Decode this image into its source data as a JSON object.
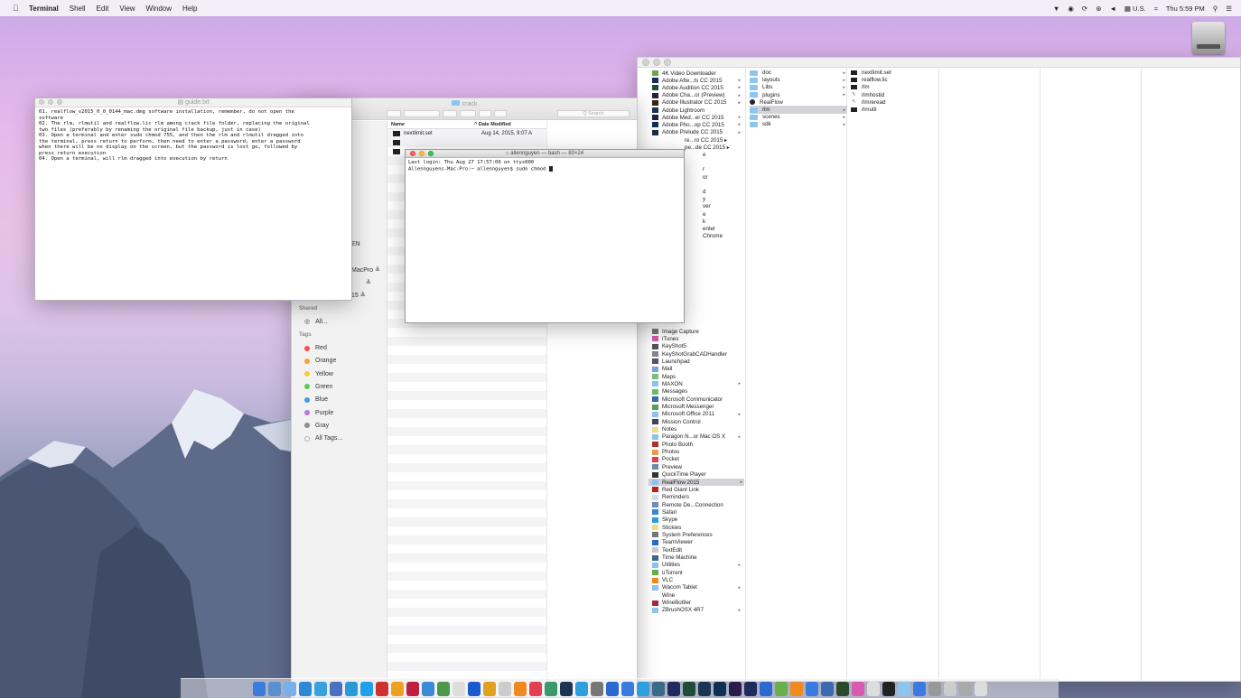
{
  "menubar": {
    "app_name": "Terminal",
    "menus": [
      "Shell",
      "Edit",
      "View",
      "Window",
      "Help"
    ],
    "status": {
      "input": "U.S.",
      "clock": "Thu 5:59 PM"
    }
  },
  "guide_window": {
    "title": "guide.txt",
    "lines": [
      "01. realflow_v2015_0_0_0144_mac.dmg software installation, remember, do not open the",
      "software",
      "02. The rlm, rlmutil and realflow.lic rlm among crack file folder, replacing the original",
      "two files (preferably by renaming the original file backup, just in case)",
      "03. Open a terminal and enter sudo chmod 755, and then the rlm and rlmutil dragged into",
      "the terminal, press return to perform, then need to enter a password, enter a password",
      "when there will be no display on the screen, but the password is lost go, followed by",
      "press return execution",
      "04. Open a terminal, will rlm dragged into execution by return"
    ]
  },
  "crack_window": {
    "title": "crack",
    "search_placeholder": "Q Search",
    "col_name": "Name",
    "col_date": "^  Date Modified",
    "files": [
      {
        "name": "nextlimit.set",
        "date": "Aug 14, 2015, 9:07 A"
      }
    ],
    "sidebar_partial": [
      "EN",
      "MacPro ≜",
      "≜",
      "15    ≜"
    ],
    "shared_label": "Shared",
    "shared_all": "All...",
    "tags_label": "Tags",
    "tags": [
      {
        "name": "Red",
        "color": "#f4504a"
      },
      {
        "name": "Orange",
        "color": "#f6a23a"
      },
      {
        "name": "Yellow",
        "color": "#f4cf3a"
      },
      {
        "name": "Green",
        "color": "#5ec94f"
      },
      {
        "name": "Blue",
        "color": "#3e9bef"
      },
      {
        "name": "Purple",
        "color": "#b67bd8"
      },
      {
        "name": "Gray",
        "color": "#8e8e92"
      },
      {
        "name": "All Tags...",
        "color": "#ffffff"
      }
    ]
  },
  "terminal": {
    "title": "allennguyen — bash — 80×24",
    "line1": "Last login: Thu Aug 27 17:57:00 on ttys000",
    "line2": "Allennguyens-Mac-Pro:~ allennguyen$ sudo chmod "
  },
  "apps_window": {
    "applications": [
      {
        "name": "4K Video Downloader",
        "color": "#6aa84f",
        "arrow": false
      },
      {
        "name": "Adobe Afte...ts CC 2015",
        "color": "#1f2a5e",
        "arrow": true
      },
      {
        "name": "Adobe Audition CC 2015",
        "color": "#1c4c3a",
        "arrow": true
      },
      {
        "name": "Adobe Cha...or (Preview)",
        "color": "#2a1f3d",
        "arrow": true
      },
      {
        "name": "Adobe Illustrator CC 2015",
        "color": "#3a2410",
        "arrow": true
      },
      {
        "name": "Adobe Lightroom",
        "color": "#1c3552",
        "arrow": false
      },
      {
        "name": "Adobe Med...er CC 2015",
        "color": "#2a1c48",
        "arrow": true
      },
      {
        "name": "Adobe Pho...op CC 2015",
        "color": "#0f3052",
        "arrow": true
      },
      {
        "name": "Adobe Prelude CC 2015",
        "color": "#1c2f4a",
        "arrow": true
      },
      {
        "name": "Image Capture",
        "color": "#777",
        "arrow": false
      },
      {
        "name": "iTunes",
        "color": "#d95ab0",
        "arrow": false
      },
      {
        "name": "KeyShot5",
        "color": "#555",
        "arrow": false
      },
      {
        "name": "KeyShotGrabCADHandler",
        "color": "#888",
        "arrow": false
      },
      {
        "name": "Launchpad",
        "color": "#556",
        "arrow": false
      },
      {
        "name": "Mail",
        "color": "#7aa6d6",
        "arrow": false
      },
      {
        "name": "Maps",
        "color": "#7cc07a",
        "arrow": false
      },
      {
        "name": "MAXON",
        "color": "#8ec5ef",
        "arrow": true
      },
      {
        "name": "Messages",
        "color": "#6ac06a",
        "arrow": false
      },
      {
        "name": "Microsoft Communicator",
        "color": "#3a6ab0",
        "arrow": false
      },
      {
        "name": "Microsoft Messenger",
        "color": "#5aa05a",
        "arrow": false
      },
      {
        "name": "Microsoft Office 2011",
        "color": "#8ec5ef",
        "arrow": true
      },
      {
        "name": "Mission Control",
        "color": "#445",
        "arrow": false
      },
      {
        "name": "Notes",
        "color": "#f2df8a",
        "arrow": false
      },
      {
        "name": "Paragon N...or Mac OS X",
        "color": "#8ec5ef",
        "arrow": true
      },
      {
        "name": "Photo Booth",
        "color": "#b03030",
        "arrow": false
      },
      {
        "name": "Photos",
        "color": "#e6a050",
        "arrow": false
      },
      {
        "name": "Pocket",
        "color": "#e04050",
        "arrow": false
      },
      {
        "name": "Preview",
        "color": "#6a8cb0",
        "arrow": false
      },
      {
        "name": "QuickTime Player",
        "color": "#333",
        "arrow": false
      },
      {
        "name": "RealFlow 2015",
        "color": "#8ec5ef",
        "arrow": true
      },
      {
        "name": "Red Giant Link",
        "color": "#c02020",
        "arrow": false
      },
      {
        "name": "Reminders",
        "color": "#ddd",
        "arrow": false
      },
      {
        "name": "Remote De...Connection",
        "color": "#7090c0",
        "arrow": false
      },
      {
        "name": "Safari",
        "color": "#3a8ad6",
        "arrow": false
      },
      {
        "name": "Skype",
        "color": "#2aa0e0",
        "arrow": false
      },
      {
        "name": "Stickies",
        "color": "#f2df8a",
        "arrow": false
      },
      {
        "name": "System Preferences",
        "color": "#777",
        "arrow": false
      },
      {
        "name": "TeamViewer",
        "color": "#2a6ad0",
        "arrow": false
      },
      {
        "name": "TextEdit",
        "color": "#ccc",
        "arrow": false
      },
      {
        "name": "Time Machine",
        "color": "#3a6a8a",
        "arrow": false
      },
      {
        "name": "Utilities",
        "color": "#8ec5ef",
        "arrow": true
      },
      {
        "name": "uTorrent",
        "color": "#6ab04a",
        "arrow": false
      },
      {
        "name": "VLC",
        "color": "#f08a20",
        "arrow": false
      },
      {
        "name": "Wacom Tablet",
        "color": "#8ec5ef",
        "arrow": true
      },
      {
        "name": "Wine",
        "color": "#fff",
        "arrow": false
      },
      {
        "name": "WineBottler",
        "color": "#a02a40",
        "arrow": false
      },
      {
        "name": "ZBrushOSX 4R7",
        "color": "#8ec5ef",
        "arrow": true
      }
    ],
    "partial_fragments": [
      "re...ro CC 2015  ▸",
      "pe...de CC 2015  ▸",
      "e",
      "",
      "r",
      "or",
      "",
      "d",
      "y",
      "ver",
      "e",
      "k",
      "enter",
      "Chrome"
    ],
    "realflow_folders": [
      {
        "name": "doc",
        "arrow": true
      },
      {
        "name": "layouts",
        "arrow": true
      },
      {
        "name": "Libs",
        "arrow": true
      },
      {
        "name": "plugins",
        "arrow": true
      },
      {
        "name": "RealFlow",
        "arrow": false,
        "app": true
      },
      {
        "name": "rlm",
        "arrow": true,
        "selected": true
      },
      {
        "name": "scenes",
        "arrow": true
      },
      {
        "name": "sdk",
        "arrow": true
      }
    ],
    "rlm_files": [
      {
        "name": "nextlimit.set",
        "kind": "binary"
      },
      {
        "name": "realflow.lic",
        "kind": "binary"
      },
      {
        "name": "rlm",
        "kind": "binary"
      },
      {
        "name": "rlmhostid",
        "kind": "pointer"
      },
      {
        "name": "rlmreread",
        "kind": "pointer"
      },
      {
        "name": "rlmutil",
        "kind": "binary"
      }
    ]
  },
  "dock": {
    "colors": [
      "#3a7be0",
      "#5a8fd0",
      "#7ab0e8",
      "#2a8ad6",
      "#3aa0e0",
      "#4a70c0",
      "#2a9ad6",
      "#1fa0e8",
      "#d03030",
      "#f0a020",
      "#c02040",
      "#3a8ad6",
      "#4a9a4a",
      "#ddd",
      "#1a5ad0",
      "#e0a020",
      "#ccc",
      "#f08a20",
      "#e04050",
      "#3a9a6a",
      "#1c3552",
      "#2aa0e0",
      "#777",
      "#2a6ad0",
      "#3a7be0",
      "#2aa0e0",
      "#3a6a8a",
      "#1f2a5e",
      "#1c4c3a",
      "#1c3552",
      "#0f3052",
      "#2a1c48",
      "#1f2a5e",
      "#2a6ad0",
      "#6ab04a",
      "#f08a20",
      "#3a7be0",
      "#3a6ab0",
      "#2a4a2a",
      "#d95ab0",
      "#ddd",
      "#222",
      "#8ec5ef",
      "#3a7be0",
      "#999",
      "#ccc",
      "#aaa",
      "#ddd"
    ]
  }
}
